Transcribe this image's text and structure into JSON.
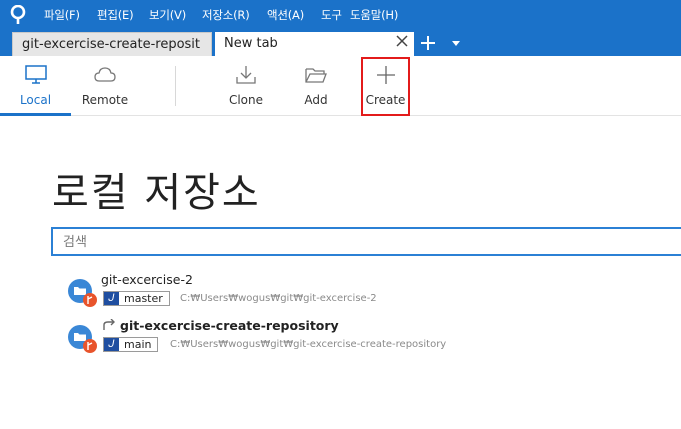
{
  "menu": {
    "items": [
      "파일(F)",
      "편집(E)",
      "보기(V)",
      "저장소(R)",
      "액션(A)",
      "도구",
      "도움말(H)"
    ]
  },
  "tabs": [
    {
      "label": "git-excercise-create-reposit",
      "active": false
    },
    {
      "label": "New tab",
      "active": true
    }
  ],
  "toolbar": {
    "local": "Local",
    "remote": "Remote",
    "clone": "Clone",
    "add": "Add",
    "create": "Create"
  },
  "main": {
    "title": "로컬 저장소",
    "search_placeholder": "검색",
    "repos": [
      {
        "name": "git-excercise-2",
        "branch": "master",
        "path": "C:₩Users₩wogus₩git₩git-excercise-2"
      },
      {
        "name": "git-excercise-create-repository",
        "branch": "main",
        "path": "C:₩Users₩wogus₩git₩git-excercise-create-repository"
      }
    ]
  },
  "colors": {
    "accent": "#1b72c9",
    "highlight": "#e31b1b",
    "branch_badge": "#1f4ea0",
    "repo_icon": "#3a87d6",
    "repo_badge": "#e8542c"
  }
}
